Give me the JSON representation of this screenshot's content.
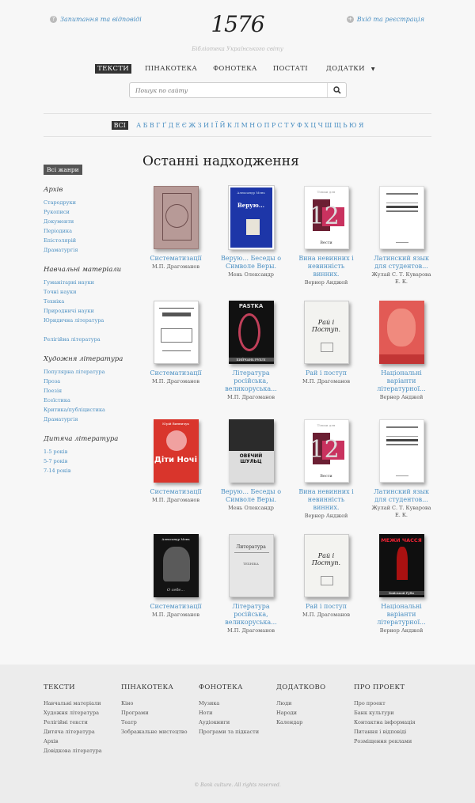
{
  "header": {
    "faq_link": "Запитання та відповіді",
    "login_link": "Вхід та реєстрація",
    "logo": "1576",
    "tagline": "Бібліотека Українського світу"
  },
  "nav": {
    "items": [
      "ТЕКСТИ",
      "ПІНАКОТЕКА",
      "ФОНОТЕКА",
      "ПОСТАТІ",
      "ДОДАТКИ"
    ],
    "active": "ТЕКСТИ"
  },
  "search": {
    "placeholder": "Пошук по сайту"
  },
  "alphabet": {
    "all_label": "ВСІ",
    "letters": [
      "А",
      "Б",
      "В",
      "Г",
      "Ґ",
      "Д",
      "Е",
      "Є",
      "Ж",
      "З",
      "И",
      "І",
      "Ї",
      "Й",
      "К",
      "Л",
      "М",
      "Н",
      "О",
      "П",
      "Р",
      "С",
      "Т",
      "У",
      "Ф",
      "Х",
      "Ц",
      "Ч",
      "Ш",
      "Щ",
      "Ь",
      "Ю",
      "Я"
    ]
  },
  "sidebar": {
    "genres_button": "Всі жанри",
    "categories": [
      {
        "title": "Архів",
        "items": [
          "Стародруки",
          "Рукописи",
          "Документи",
          "Періодика",
          "Епістолярій",
          "Драматургія"
        ]
      },
      {
        "title": "Навчальні матеріали",
        "items": [
          "Гуманітарні науки",
          "Точні науки",
          "Техніка",
          "Природничі науки",
          "Юридична література",
          "",
          "Релігійна література"
        ]
      },
      {
        "title": "Художня література",
        "items": [
          "Популярна література",
          "Проза",
          "Поезія",
          "Есеїстика",
          "Критика/публіцистика",
          "Драматургія"
        ]
      },
      {
        "title": "Дитяча література",
        "items": [
          "1-5 років",
          "5-7 років",
          "7-14 років"
        ]
      }
    ]
  },
  "main": {
    "heading": "Останні надходження",
    "books": [
      {
        "title": [
          "Систематизації"
        ],
        "author": "М.П. Драгоманов"
      },
      {
        "title": [
          "Верую... Беседы о",
          "Символе Веры."
        ],
        "author": "Мень Олександр"
      },
      {
        "title": [
          "Вина невинних і",
          "невинність винних."
        ],
        "author": "Вернер Анджей"
      },
      {
        "title": [
          "Латинский язык",
          "для студентов..."
        ],
        "author": "Жулай С. Т. Куварова Е. К."
      },
      {
        "title": [
          "Систематизації"
        ],
        "author": "М.П. Драгоманов"
      },
      {
        "title": [
          "Література",
          "російська,",
          "великоруська..."
        ],
        "author": "М.П. Драгоманов"
      },
      {
        "title": [
          "Рай і поступ"
        ],
        "author": "М.П. Драгоманов"
      },
      {
        "title": [
          "Національні",
          "варіанти",
          "літературної..."
        ],
        "author": "Вернер Анджей"
      },
      {
        "title": [
          "Систематизації"
        ],
        "author": "М.П. Драгоманов"
      },
      {
        "title": [
          "Верую... Беседы о",
          "Символе Веры."
        ],
        "author": "Мень Олександр"
      },
      {
        "title": [
          "Вина невинних і",
          "невинність винних."
        ],
        "author": "Вернер Анджей"
      },
      {
        "title": [
          "Латинский язык",
          "для студентов..."
        ],
        "author": "Жулай С. Т. Куварова Е. К."
      },
      {
        "title": [
          "Систематизації"
        ],
        "author": "М.П. Драгоманов"
      },
      {
        "title": [
          "Література",
          "російська,",
          "великоруська..."
        ],
        "author": "М.П. Драгоманов"
      },
      {
        "title": [
          "Рай і поступ"
        ],
        "author": "М.П. Драгоманов"
      },
      {
        "title": [
          "Національні",
          "варіанти",
          "літературної..."
        ],
        "author": "Вернер Анджей"
      }
    ],
    "cover_texts": {
      "verbatim_blue": "Верую...",
      "verbatim_blue_top": "Александр Мень",
      "vina_top": "Тільки для",
      "vina_bottom": "Вести",
      "past": "PASTKA",
      "pasta_bottom": "БИЙЧАНЬ РУБЛІ",
      "rai": "Рай і Поступ.",
      "diti": "Діти Ночі",
      "diti_author": "Юрій Винничук",
      "ovcha": "ОВЕЧИЙ ШУЛЬЦ",
      "lit": "Литература",
      "lit_sub": "ТЕХНІКА",
      "menn_author": "Александр Мень",
      "menn_sub": "О себе...",
      "mezhy": "МЕЖИ ЧАССЯ",
      "mezhy_bottom": "Кийськой Руби"
    }
  },
  "footer": {
    "columns": [
      {
        "title": "ТЕКСТИ",
        "items": [
          "Навчальні матеріали",
          "Художня література",
          "Релігійні тексти",
          "Дитяча література",
          "Архів",
          "Довідкова література"
        ]
      },
      {
        "title": "ПІНАКОТЕКА",
        "items": [
          "Кіно",
          "Програми",
          "Театр",
          "Зображальне мистецтво"
        ]
      },
      {
        "title": "ФОНОТЕКА",
        "items": [
          "Музика",
          "Ноти",
          "Аудіокниги",
          "Програми та підкасти"
        ]
      },
      {
        "title": "ДОДАТКОВО",
        "items": [
          "Люди",
          "Народи",
          "Календар"
        ]
      },
      {
        "title": "ПРО ПРОЕКТ",
        "items": [
          "Про проект",
          "Банк культури",
          "Контактна інформація",
          "Питання і відповіді",
          "Розміщення реклами"
        ]
      }
    ],
    "copyright": "© Bank culture. All rights reserved."
  },
  "colors": {
    "accent": "#4a8fc2",
    "dark": "#333333",
    "footer_bg": "#ececec"
  }
}
